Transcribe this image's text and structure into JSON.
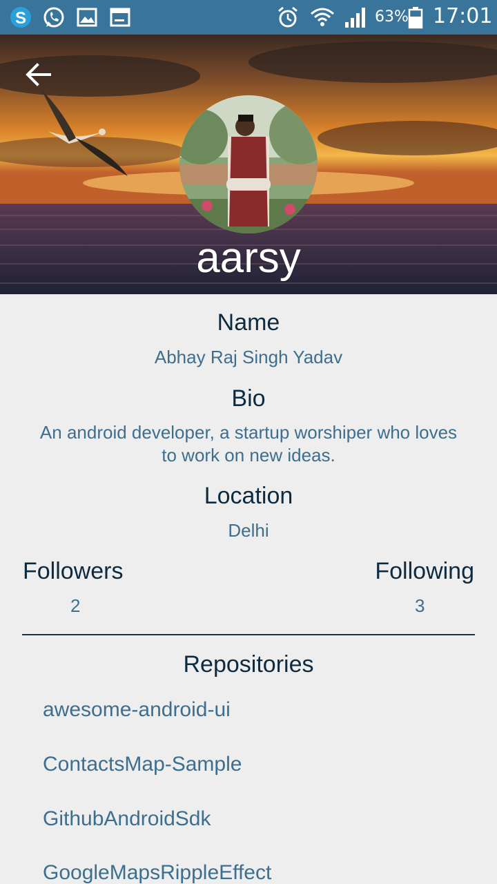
{
  "status_bar": {
    "battery": "63%",
    "time": "17:01"
  },
  "profile": {
    "username": "aarsy",
    "name_label": "Name",
    "name": "Abhay Raj Singh Yadav",
    "bio_label": "Bio",
    "bio": "An android developer, a startup worshiper who loves to work on new ideas.",
    "location_label": "Location",
    "location": "Delhi",
    "followers_label": "Followers",
    "followers": "2",
    "following_label": "Following",
    "following": "3"
  },
  "repositories": {
    "title": "Repositories",
    "items": [
      "awesome-android-ui",
      "ContactsMap-Sample",
      "GithubAndroidSdk",
      "GoogleMapsRippleEffect"
    ]
  },
  "colors": {
    "status_bar": "#39749a",
    "label": "#0e2a3e",
    "value": "#3e6e8e",
    "background": "#eeeeee"
  }
}
